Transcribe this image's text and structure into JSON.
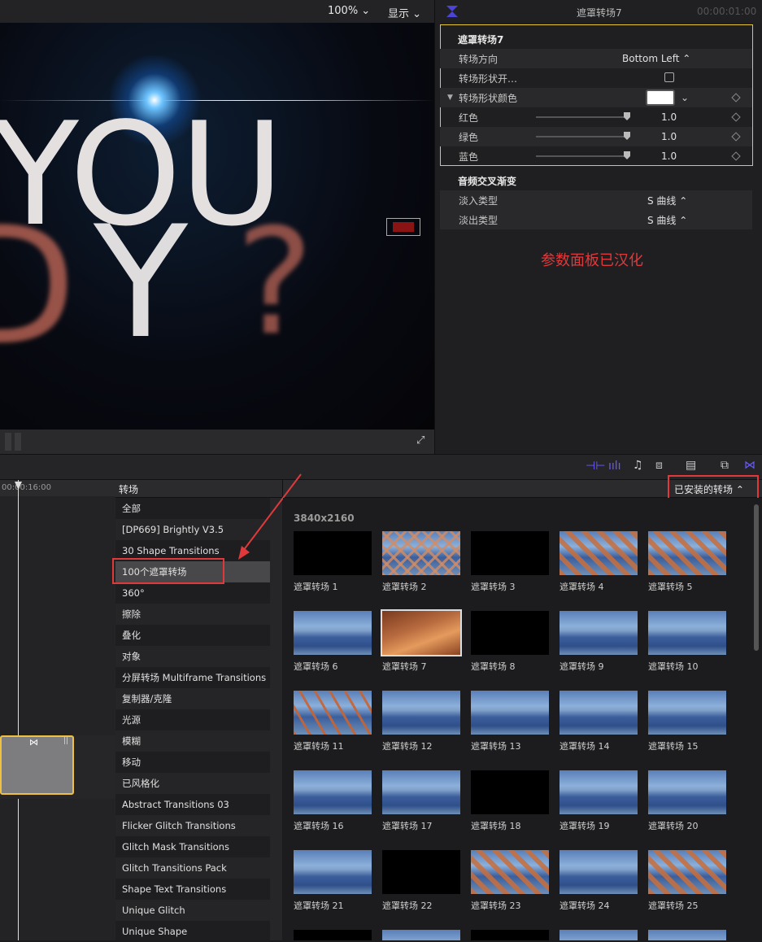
{
  "viewer": {
    "zoom": "100%",
    "display": "显示",
    "canvas_text_main": "YOU",
    "canvas_text_y": "Y",
    "canvas_text_d": "D",
    "canvas_text_q": "?"
  },
  "inspector": {
    "header_title": "遮罩转场7",
    "timecode": "00:00:01:00",
    "section_title": "遮罩转场7",
    "rows": [
      {
        "label": "转场方向",
        "value": "Bottom Left ⌃"
      },
      {
        "label": "转场形状开…",
        "value": ""
      },
      {
        "label": "转场形状颜色",
        "value": ""
      },
      {
        "label": "红色",
        "value": "1.0"
      },
      {
        "label": "绿色",
        "value": "1.0"
      },
      {
        "label": "蓝色",
        "value": "1.0"
      }
    ],
    "audio_section": "音频交叉渐变",
    "audio_rows": [
      {
        "label": "淡入类型",
        "value": "S 曲线 ⌃"
      },
      {
        "label": "淡出类型",
        "value": "S 曲线 ⌃"
      }
    ],
    "annotation": "参数面板已汉化"
  },
  "timeline": {
    "timecode": "00:00:16:00"
  },
  "browser": {
    "title": "转场",
    "dropdown": "已安装的转场",
    "resolution": "3840x2160",
    "categories": [
      "全部",
      "[DP669] Brightly V3.5",
      "30 Shape Transitions",
      "100个遮罩转场",
      "360°",
      "擦除",
      "叠化",
      "对象",
      "分屏转场 Multiframe Transitions",
      "复制器/克隆",
      "光源",
      "模糊",
      "移动",
      "已风格化",
      "Abstract Transitions 03",
      "Flicker Glitch Transitions",
      "Glitch Mask Transitions",
      "Glitch Transitions Pack",
      "Shape Text Transitions",
      "Unique Glitch",
      "Unique Shape"
    ],
    "items": [
      {
        "name": "遮罩转场 1",
        "style": "black"
      },
      {
        "name": "遮罩转场 2",
        "style": "mtn-x"
      },
      {
        "name": "遮罩转场 3",
        "style": "black"
      },
      {
        "name": "遮罩转场 4",
        "style": "mtn-orange"
      },
      {
        "name": "遮罩转场 5",
        "style": "mtn-orange"
      },
      {
        "name": "遮罩转场 6",
        "style": "mtn"
      },
      {
        "name": "遮罩转场 7",
        "style": "orange"
      },
      {
        "name": "遮罩转场 8",
        "style": "black"
      },
      {
        "name": "遮罩转场 9",
        "style": "mtn"
      },
      {
        "name": "遮罩转场 10",
        "style": "mtn"
      },
      {
        "name": "遮罩转场 11",
        "style": "mtn-stripes"
      },
      {
        "name": "遮罩转场 12",
        "style": "mtn"
      },
      {
        "name": "遮罩转场 13",
        "style": "mtn"
      },
      {
        "name": "遮罩转场 14",
        "style": "mtn"
      },
      {
        "name": "遮罩转场 15",
        "style": "mtn"
      },
      {
        "name": "遮罩转场 16",
        "style": "mtn"
      },
      {
        "name": "遮罩转场 17",
        "style": "mtn"
      },
      {
        "name": "遮罩转场 18",
        "style": "black"
      },
      {
        "name": "遮罩转场 19",
        "style": "mtn"
      },
      {
        "name": "遮罩转场 20",
        "style": "mtn"
      },
      {
        "name": "遮罩转场 21",
        "style": "mtn"
      },
      {
        "name": "遮罩转场 22",
        "style": "black"
      },
      {
        "name": "遮罩转场 23",
        "style": "mtn-orange"
      },
      {
        "name": "遮罩转场 24",
        "style": "mtn"
      },
      {
        "name": "遮罩转场 25",
        "style": "mtn-orange"
      }
    ],
    "selected_item": "遮罩转场 7",
    "selected_category": "100个遮罩转场"
  },
  "colors": {
    "highlight_red": "#e0393b",
    "inspector_border": "#e6c73a",
    "selected_clip_border": "#f0c040",
    "purple_icon": "#6b5bff"
  }
}
